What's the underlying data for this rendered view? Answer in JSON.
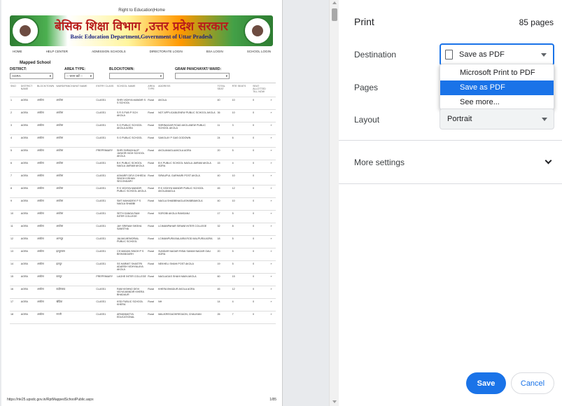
{
  "preview": {
    "page_header": "Right to Education|Home",
    "banner_hindi": "बेसिक शिक्षा विभाग ,उत्तर प्रदेश सरकार",
    "banner_english": "Basic Education Department,Government of Uttar Pradesh",
    "nav": [
      "HOME",
      "HELP CENTER",
      "ADMISSION SCHOOLS",
      "DIRECTORATE LOGIN",
      "BSA LOGIN",
      "SCHOOL LOGIN"
    ],
    "section_title": "Mapped School",
    "filters": {
      "district_label": "DISTRICT:",
      "district_value": "AGRA",
      "area_label": "AREA TYPE:",
      "area_value": "-- चयन करें --",
      "block_label": "BLOCK/TOWN:",
      "block_value": "",
      "gp_label": "GRAM PANCHAYAT/ WARD:",
      "gp_value": ""
    },
    "table_headers": [
      "SNO",
      "DISTRICT NAME",
      "BLOCK/TOWN",
      "WARD/PANCHAYAT NAME",
      "ENTRY CLASS",
      "SCHOOL NAME",
      "AREA TYPE",
      "ADDRESS",
      "TOTAL SEAT",
      "RTE SEATS",
      "SEAT ALLOTTED TILL NOW",
      ""
    ],
    "rows": [
      [
        "1",
        "AGRA",
        "अकोला",
        "अकोला",
        "CLASS1",
        "SHRI VIDHYA MANDIR S S SCHOOL",
        "Rural",
        "AKOLA",
        "40",
        "10",
        "0",
        "»"
      ],
      [
        "2",
        "AGRA",
        "अकोला",
        "अकोला",
        "CLASS1",
        "S R S PUB P SCH AKOLA",
        "Rural",
        "NOT APPLICABLENEW PUBLIC SCHOOL AKOLA",
        "36",
        "10",
        "0",
        "»"
      ],
      [
        "3",
        "AGRA",
        "अकोला",
        "अकोला",
        "CLASS1",
        "S G PUBLIC SCHOOL AKOLA AGRA",
        "Rural",
        "SHRINAGAR ROAD AKOLANEW PUBLIC SCHOOL AKOLA",
        "11",
        "3",
        "0",
        "»"
      ],
      [
        "4",
        "AGRA",
        "अकोला",
        "अकोला",
        "CLASS1",
        "S G PUBLIC SCHOOL",
        "Rural",
        "SAKOLAY P GAS GODOWN",
        "24",
        "6",
        "0",
        "»"
      ],
      [
        "5",
        "AGRA",
        "अकोला",
        "अकोला",
        "PREPRIMARY",
        "SHRI SHRADHAJIT JUNIOR HIGH SCHOOL AKOLA",
        "Rural",
        "AKOLANAGLAAKOLA AGRA",
        "20",
        "5",
        "0",
        "»"
      ],
      [
        "6",
        "AGRA",
        "अकोला",
        "अकोला",
        "CLASS1",
        "B K PUBLIC SCHOOL NAGLA JAIRAM AKOLA",
        "Rural",
        "B K PUBLIC SCHOOL NAGLA JAIRAM AKOLA AGRA",
        "15",
        "4",
        "0",
        "»"
      ],
      [
        "7",
        "AGRA",
        "अकोला",
        "अकोला",
        "CLASS1",
        "ASHARFI DEVI CHHEDU SINGH KISHAN SECONDARY",
        "Rural",
        "SIRAUPUL GARHAIRI POST AKOLA",
        "40",
        "10",
        "0",
        "»"
      ],
      [
        "8",
        "AGRA",
        "अकोला",
        "अकोला",
        "CLASS1",
        "R K VIDHYA MANDIR PUBLIC SCHOOL AKOLA",
        "Rural",
        "R K VIDHYA MANDIR PUBLIC SCHOOL AKOLANAGLA",
        "45",
        "12",
        "0",
        "»"
      ],
      [
        "9",
        "AGRA",
        "अकोला",
        "अकोला",
        "CLASS1",
        "SMT MAHADEVI P S NAGLA SHABBI",
        "Rural",
        "NAGLA SHABBINAGLASHABBIAKOLA",
        "40",
        "10",
        "0",
        "»"
      ],
      [
        "10",
        "AGRA",
        "अकोला",
        "अकोला",
        "CLASS1",
        "SETH GANGA RAM INTER COLLEGE",
        "Rural",
        "SOROBI AKOLA RAMGANJ",
        "17",
        "5",
        "0",
        "»"
      ],
      [
        "11",
        "AGRA",
        "अकोला",
        "अकोला",
        "CLASS1",
        "JAY SRIRAM SIKSHA SANSTHA",
        "Rural",
        "LCIMANPAHAR SIRAWI INTER COLLEGE",
        "32",
        "8",
        "0",
        "»"
      ],
      [
        "12",
        "AGRA",
        "अकोला",
        "अरनपुर",
        "CLASS1",
        "JALMA MEMORIAL PUBLIC SCHOOL",
        "Rural",
        "LCIMANPURA BALAIRA ROD MALPURA AGRA",
        "18",
        "5",
        "0",
        "»"
      ],
      [
        "13",
        "AGRA",
        "अकोला",
        "इटपुरवास",
        "CLASS1",
        "CH MADAN SINGH P S BISHANGARH",
        "Rural",
        "SUNDAR NAGAR RISAI SAVAM NAGAR GAU AGRA",
        "20",
        "5",
        "0",
        "»"
      ],
      [
        "14",
        "AGRA",
        "अकोला",
        "इटापुर",
        "CLASS1",
        "SS HARMIT SHASTRI ADARSH VIDHYALAYA AKOLA",
        "Rural",
        "NEKHELI SHAHI POST AKOLA",
        "19",
        "5",
        "0",
        "»"
      ],
      [
        "15",
        "AGRA",
        "अकोला",
        "बलपुर",
        "PREPRIMARY",
        "LAGHE INTER COLLEGE",
        "Rural",
        "NAGLAGAS SHAHI MAIN AKOLA",
        "60",
        "15",
        "0",
        "»"
      ],
      [
        "16",
        "AGRA",
        "अकोला",
        "कड़ौराबाद",
        "CLASS1",
        "RAM KISHNO DEVI VIDYA MANDIR KHERA BHADAUR",
        "Rural",
        "KHERA BHADUR AKOLA AGRA",
        "45",
        "12",
        "0",
        "»"
      ],
      [
        "17",
        "AGRA",
        "अकोला",
        "खेड़िया",
        "CLASS1",
        "KSD PUBLIC SCHOOL KHERA",
        "Rural",
        "NH",
        "14",
        "4",
        "0",
        "»"
      ],
      [
        "18",
        "AGRA",
        "अकोला",
        "नगली",
        "CLASS1",
        "ARVANMATYA EDUCATIONAL",
        "Rural",
        "MALIKREGAOKREGAON, CHAUHAN",
        "26",
        "7",
        "0",
        "»"
      ]
    ],
    "footer_url": "https://rte25.upsdc.gov.in/RptMappedSchoolPublic.aspx",
    "footer_page": "1/85"
  },
  "settings": {
    "title": "Print",
    "page_count": "85 pages",
    "destination_label": "Destination",
    "destination_value": "Save as PDF",
    "destination_options": [
      "Microsoft Print to PDF",
      "Save as PDF",
      "See more..."
    ],
    "pages_label": "Pages",
    "layout_label": "Layout",
    "layout_value": "Portrait",
    "more_settings_label": "More settings",
    "save_label": "Save",
    "cancel_label": "Cancel"
  },
  "colors": {
    "accent": "#1a73e8",
    "text": "#202124"
  }
}
